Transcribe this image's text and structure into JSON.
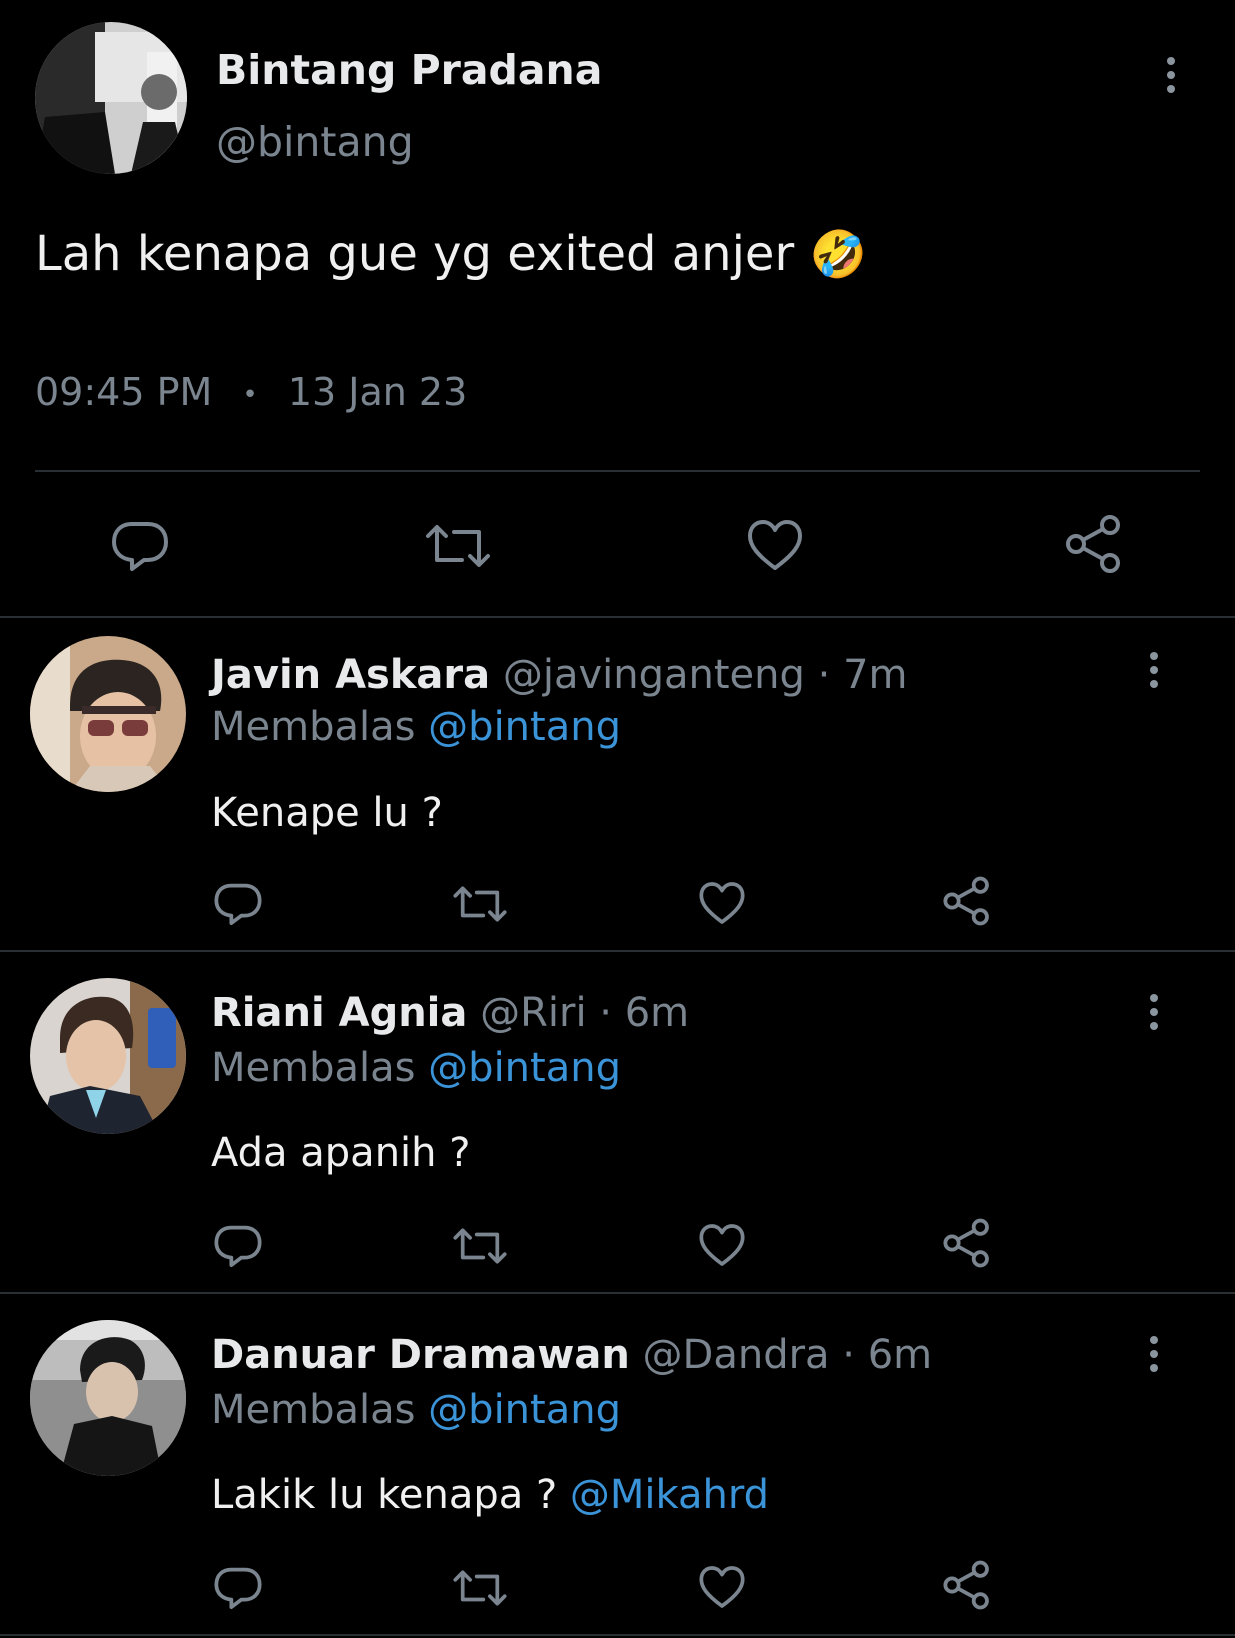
{
  "main_tweet": {
    "name": "Bintang Pradana",
    "handle": "@bintang",
    "text": "Lah kenapa gue yg exited anjer",
    "emoji": "🤣",
    "time": "09:45 PM",
    "separator": "•",
    "date": "13 Jan 23"
  },
  "replies": [
    {
      "name": "Javin Askara",
      "handle": "@javinganteng",
      "dot": "·",
      "time": "7m",
      "reply_prefix": "Membalas",
      "reply_to": "@bintang",
      "text": "Kenape lu ?",
      "mention": ""
    },
    {
      "name": "Riani Agnia",
      "handle": "@Riri",
      "dot": "·",
      "time": "6m",
      "reply_prefix": "Membalas",
      "reply_to": "@bintang",
      "text": "Ada apanih ?",
      "mention": ""
    },
    {
      "name": "Danuar Dramawan",
      "handle": "@Dandra",
      "dot": "·",
      "time": "6m",
      "reply_prefix": "Membalas",
      "reply_to": "@bintang",
      "text": "Lakik lu kenapa ?",
      "mention": "@Mikahrd"
    }
  ],
  "icons": [
    "more-vertical-icon",
    "reply-icon",
    "retweet-icon",
    "like-icon",
    "share-icon"
  ],
  "colors": {
    "background": "#000000",
    "text": "#e7e9ea",
    "muted": "#7b858f",
    "link": "#3b93d8",
    "divider": "#2a2f33"
  }
}
